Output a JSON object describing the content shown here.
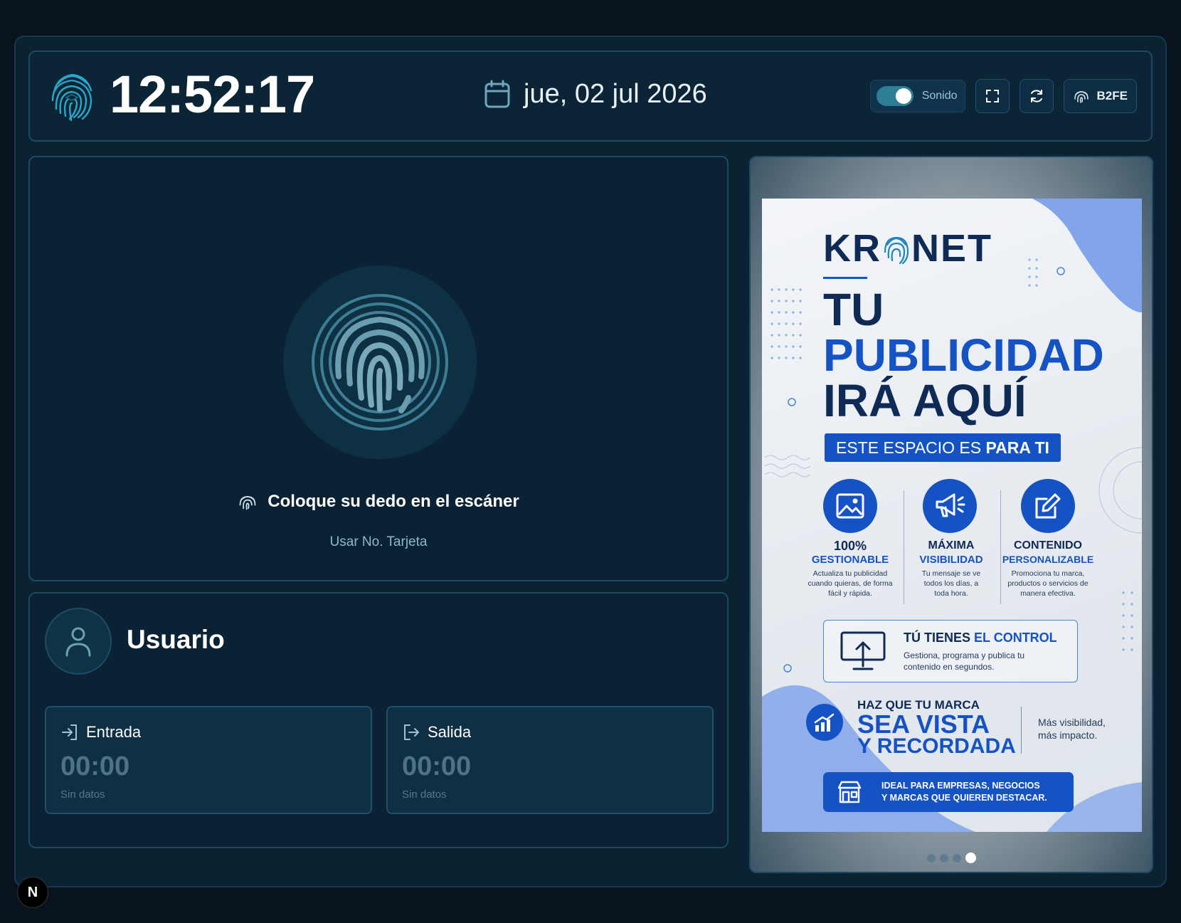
{
  "header": {
    "clock": "12:52:17",
    "date": "jue, 02 jul 2026",
    "sound_label": "Sonido",
    "sound_on": true,
    "device_label": "B2FE"
  },
  "scanner": {
    "prompt": "Coloque su dedo en el escáner",
    "card_link": "Usar No. Tarjeta"
  },
  "user": {
    "name": "Usuario",
    "entrada": {
      "label": "Entrada",
      "time": "00:00",
      "status": "Sin datos"
    },
    "salida": {
      "label": "Salida",
      "time": "00:00",
      "status": "Sin datos"
    }
  },
  "ad": {
    "brand_left": "KR",
    "brand_right": "NET",
    "headline_1": "TU",
    "headline_2": "PUBLICIDAD",
    "headline_3": "IRÁ AQUÍ",
    "tagline_prefix": "ESTE ESPACIO ES ",
    "tagline_bold": "PARA TI",
    "features": [
      {
        "title_1": "100%",
        "title_2": "GESTIONABLE",
        "desc_1": "Actualiza tu publicidad",
        "desc_2": "cuando quieras, de forma",
        "desc_3": "fácil y rápida."
      },
      {
        "title_1": "MÁXIMA",
        "title_2": "VISIBILIDAD",
        "desc_1": "Tu mensaje se ve",
        "desc_2": "todos los días, a",
        "desc_3": "toda hora."
      },
      {
        "title_1": "CONTENIDO",
        "title_2": "PERSONALIZABLE",
        "desc_1": "Promociona tu marca,",
        "desc_2": "productos o servicios de",
        "desc_3": "manera efectiva."
      }
    ],
    "control_title_a": "TÚ TIENES ",
    "control_title_b": "EL CONTROL",
    "control_desc_1": "Gestiona, programa y publica tu",
    "control_desc_2": "contenido en segundos.",
    "brand_line_1": "HAZ QUE TU MARCA",
    "brand_line_2": "SEA VISTA",
    "brand_line_3": "Y RECORDADA",
    "impact_1": "Más visibilidad,",
    "impact_2": "más impacto.",
    "cta_1": "IDEAL PARA EMPRESAS, NEGOCIOS",
    "cta_2": "Y MARCAS QUE QUIEREN DESTACAR."
  },
  "carousel": {
    "count": 4,
    "active_index": 3
  },
  "badge": "N",
  "colors": {
    "background": "#08131d",
    "panel": "#0a2233",
    "border": "#1d4a60",
    "accent": "#2d7f95",
    "ad_blue": "#1553c4",
    "ad_navy": "#0e2a55"
  }
}
